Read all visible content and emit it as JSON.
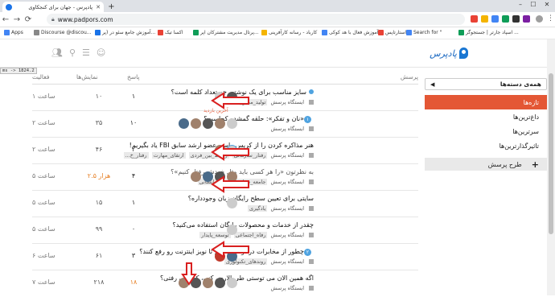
{
  "browser": {
    "tab_title": "پادپرس - جهان برای کنجکاوی",
    "url": "www.padpors.com",
    "bookmarks": [
      "Apps",
      "Discourse @discou...",
      "آموزش جامع سئو در (پر...",
      "اکسا تیک",
      "پرتال مدیریت مشترکان اپر...",
      "کارباد - رسانه کارآفرینی",
      "آموزش فعال با هد کوکی...",
      "استارتاپس",
      "Search for \"",
      "اسپاد جارتر | جستجوگر ..."
    ]
  },
  "debug_badge": "ms -> 1824.2",
  "site": {
    "logo_text": "پادپرس"
  },
  "sidebar": {
    "category_select": "همه‌ی دسته‌ها",
    "items": [
      "تازه‌ها",
      "داغ‌ترین‌ها",
      "سرترین‌ها",
      "تاثیرگذارترین‌ها"
    ],
    "new_topic": "طرح پرسش"
  },
  "table": {
    "headers": {
      "topic": "پرسش",
      "replies": "پاسخ",
      "views": "نمایش‌ها",
      "activity": "فعالیت"
    },
    "last_visit": "آخرین بازدید",
    "rows": [
      {
        "title": "سایز مناسب برای یک نوشته، چه تعداد کلمه است؟",
        "category": "ایستگاه پرسش",
        "tags": [
          "تولید_محتوا"
        ],
        "replies": "۱",
        "views": "۱۰",
        "activity": "۱ ساعت"
      },
      {
        "title": "«نان و تفکر»: حلقه گمشده کجاست؟",
        "category": "ایستگاه پرسش",
        "tags": [],
        "badge": "۱",
        "replies": "۱۰",
        "views": "۳۵",
        "activity": "۲ ساعت"
      },
      {
        "title": "هنر مذاکره کردن را از کریس واس، عضو ارشد سابق FBI یاد بگیریم!",
        "category": "ایستگاه پرسش",
        "tags": [
          "رفتار_سازمانی",
          "روابط_بین_فردی",
          "ارتقای_مهارت",
          "رفتار_خ..."
        ],
        "replies": "۲",
        "views": "۴۶",
        "activity": "۲ ساعت"
      },
      {
        "title": "به نظرتون «را هر کسی باید مثل خودش رفتار کنیم»؟",
        "category": "ایستگاه پرسش",
        "tags": [
          "جامعه_شناسی",
          "علوم_انسانی"
        ],
        "replies": "۴",
        "views": "۲.۵ هزار",
        "activity": "۵ ساعت"
      },
      {
        "title": "سایتی برای تعیین سطح رایگان زبان وجودداره؟",
        "category": "ایستگاه پرسش",
        "tags": [
          "یادگیری"
        ],
        "replies": "۱",
        "views": "۱۵",
        "activity": "۵ ساعت"
      },
      {
        "title": "چقدر از خدمات و محصولات رایگان استفاده می‌کنید؟",
        "category": "ایستگاه پرسش",
        "tags": [
          "رفاه_اجتماعی",
          "توسعه_پایدار"
        ],
        "replies": "۰",
        "views": "۹۹",
        "activity": "۵ ساعت"
      },
      {
        "title": "چطور از مخابرات درخواست کنیم تا نویز اینترنت رو رفع کنند؟",
        "category": "ایستگاه پرسش",
        "tags": [
          "روندهای_تکنولوژی"
        ],
        "badge": "۲",
        "replies": "۳",
        "views": "۶۱",
        "activity": "۶ ساعت"
      },
      {
        "title": "اگه همین الان می توستی طی الارض کنی، کجا می رفتی؟",
        "category": "ایستگاه پرسش",
        "tags": [],
        "replies": "۱۸",
        "views": "۲۱۸",
        "activity": "۷ ساعت"
      }
    ]
  },
  "colors": {
    "accent": "#e45735",
    "arrow": "#d92020",
    "link": "#1565c0"
  }
}
